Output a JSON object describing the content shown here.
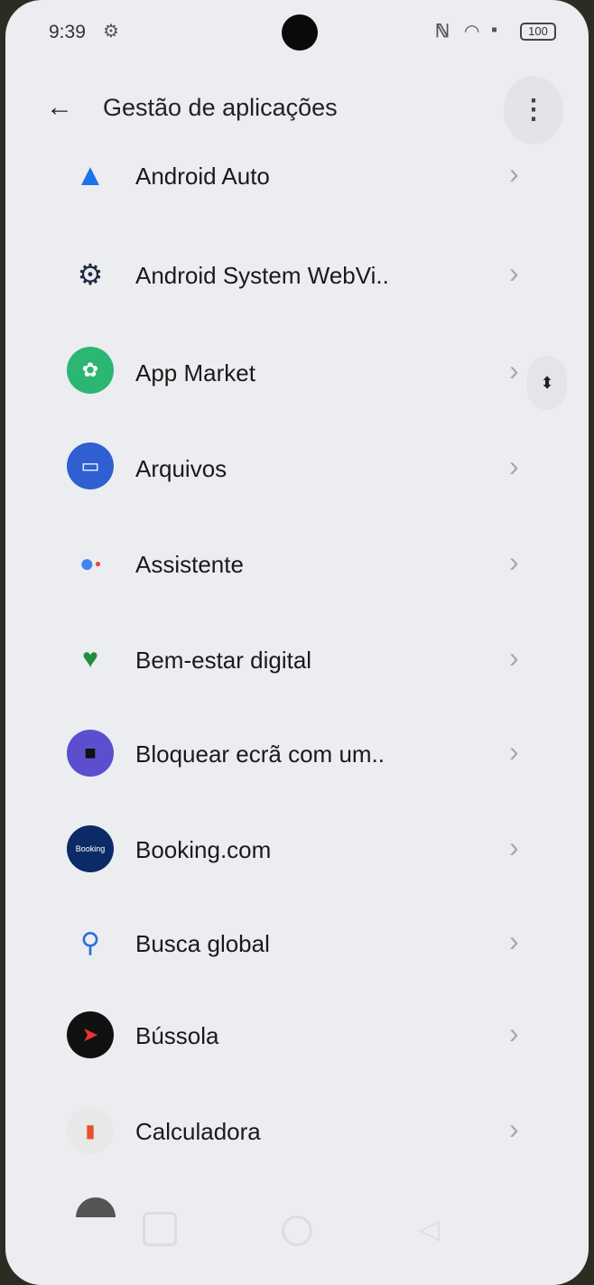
{
  "status_bar": {
    "time": "9:39",
    "battery": "100",
    "icons": [
      "settings-icon",
      "nfc-icon",
      "wifi-icon",
      "sim-icon"
    ]
  },
  "app_bar": {
    "title": "Gestão de aplicações",
    "back_icon": "arrow-left-icon",
    "more_icon": "more-vertical-icon"
  },
  "apps": [
    {
      "label": "Android Auto",
      "icon": "android-auto-icon",
      "color": "#1a73e8"
    },
    {
      "label": "Android System WebVi..",
      "icon": "gear-icon",
      "color": "#1f2a44"
    },
    {
      "label": "App Market",
      "icon": "app-market-icon",
      "color": "#2bb673"
    },
    {
      "label": "Arquivos",
      "icon": "folder-icon",
      "color": "#2f5fd0"
    },
    {
      "label": "Assistente",
      "icon": "assistant-icon",
      "color": "#4285f4"
    },
    {
      "label": "Bem-estar digital",
      "icon": "digital-wellbeing-icon",
      "color": "#1e8e3e"
    },
    {
      "label": "Bloquear ecrã com um..",
      "icon": "lock-icon",
      "color": "#5b4fcf"
    },
    {
      "label": "Booking.com",
      "icon": "booking-icon",
      "color": "#0b2a66"
    },
    {
      "label": "Busca global",
      "icon": "search-icon",
      "color": "#2d6fd8"
    },
    {
      "label": "Bússola",
      "icon": "compass-icon",
      "color": "#111111"
    },
    {
      "label": "Calculadora",
      "icon": "calculator-icon",
      "color": "#e8e8e8"
    }
  ],
  "icon_text": {
    "booking": "Booking"
  },
  "navbar": {
    "recent_icon": "recent-apps-icon",
    "home_icon": "home-icon",
    "back_icon": "nav-back-icon"
  }
}
